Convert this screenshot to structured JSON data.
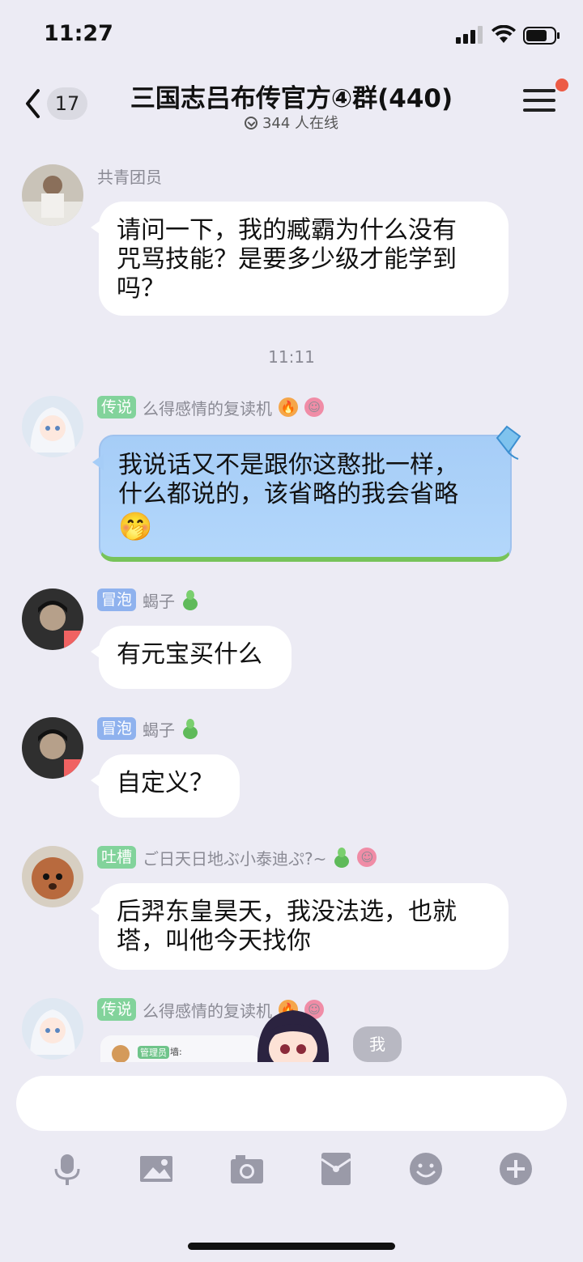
{
  "status": {
    "time": "11:27"
  },
  "header": {
    "back_badge": "17",
    "title": "三国志吕布传官方④群(440)",
    "online_text": "344 人在线"
  },
  "messages": [
    {
      "name": "共青团员",
      "text_lines": [
        "请问一下，我的臧霸为什么没有",
        "咒骂技能？是要多少级才能学到",
        "吗？"
      ]
    },
    {
      "tag": "传说",
      "name": "么得感情的复读机",
      "text_lines": [
        "我说话又不是跟你这憨批一样，",
        "什么都说的，该省略的我会省略"
      ],
      "emoji": "🤭"
    },
    {
      "tag": "冒泡",
      "name": "蝎子",
      "text": "有元宝买什么"
    },
    {
      "tag": "冒泡",
      "name": "蝎子",
      "text": "自定义？"
    },
    {
      "tag": "吐槽",
      "name": "ご日天日地ぶ小泰迪ぷ?~",
      "text_lines": [
        "后羿东皇昊天，我没法选，也就",
        "塔，叫他今天找你"
      ]
    },
    {
      "tag": "传说",
      "name": "么得感情的复读机",
      "preview_tag": "管理员",
      "preview_label": "墙:",
      "side_label": "我"
    }
  ],
  "timestamp": "11:11",
  "toolbar": [
    "mic-icon",
    "image-icon",
    "camera-icon",
    "red-packet-icon",
    "emoji-icon",
    "plus-icon"
  ],
  "colors": {
    "tag_green": "#82d39b",
    "tag_blue": "#8fb2ee",
    "notify_dot": "#ec5b45"
  }
}
